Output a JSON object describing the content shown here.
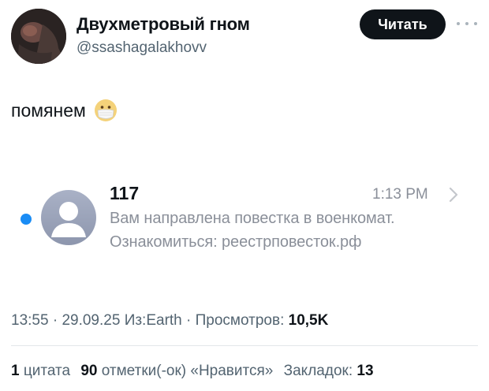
{
  "author": {
    "display_name": "Двухметровый гном",
    "handle": "@ssashagalakhovv",
    "follow_label": "Читать"
  },
  "tweet": {
    "text": "помянем",
    "emoji": "face-with-mask-emoji"
  },
  "embedded_notification": {
    "sender": "117",
    "time": "1:13 PM",
    "line1": "Вам направлена повестка в военкомат.",
    "line2": "Ознакомиться: реестрповесток.рф",
    "dot_color": "#1a8cf5"
  },
  "meta": {
    "time": "13:55",
    "sep1": "·",
    "date": "29.09.25",
    "source": "Из:Earth",
    "sep2": "·",
    "views_label": "Просмотров:",
    "views_value": "10,5K"
  },
  "stats": {
    "quotes_count": "1",
    "quotes_label": "цитата",
    "likes_count": "90",
    "likes_label": "отметки(-ок) «Нравится»",
    "bookmarks_label": "Закладок:",
    "bookmarks_count": "13"
  }
}
